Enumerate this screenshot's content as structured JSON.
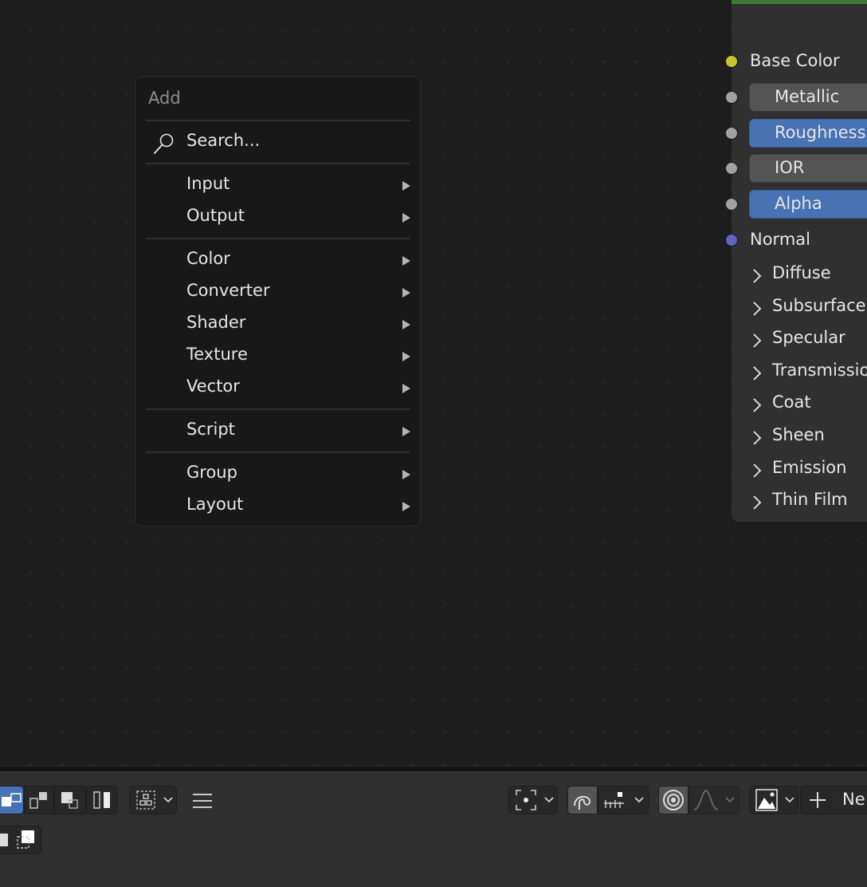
{
  "add_menu": {
    "title": "Add",
    "search_placeholder": "Search...",
    "groups": [
      [
        "Input",
        "Output"
      ],
      [
        "Color",
        "Converter",
        "Shader",
        "Texture",
        "Vector"
      ],
      [
        "Script"
      ],
      [
        "Group",
        "Layout"
      ]
    ],
    "items": {
      "input": "Input",
      "output": "Output",
      "color": "Color",
      "converter": "Converter",
      "shader": "Shader",
      "texture": "Texture",
      "vector": "Vector",
      "script": "Script",
      "group": "Group",
      "layout": "Layout"
    }
  },
  "node": {
    "inputs": {
      "base_color": "Base Color",
      "metallic": "Metallic",
      "roughness": "Roughness",
      "ior": "IOR",
      "alpha": "Alpha",
      "normal": "Normal"
    },
    "panels": {
      "diffuse": "Diffuse",
      "subsurface": "Subsurface",
      "specular": "Specular",
      "transmission": "Transmissio",
      "coat": "Coat",
      "sheen": "Sheen",
      "emission": "Emission",
      "thin_film": "Thin Film"
    },
    "socket_colors": {
      "color": "#c7c729",
      "float": "#a1a1a1",
      "vector": "#6363c7"
    },
    "header_color": "#3c7a34"
  },
  "header": {
    "new_button_label": "Ne",
    "selection_modes": [
      "set",
      "extend",
      "subtract",
      "difference"
    ],
    "icons": [
      "node-select-icon",
      "menu-icon",
      "pivot-icon",
      "snap-icon",
      "snap-increment-icon",
      "proportional-icon",
      "falloff-icon",
      "image-icon",
      "plus-icon"
    ]
  },
  "colors": {
    "accent": "#4772b3",
    "background": "#1d1d1d",
    "menu_bg": "#181818"
  }
}
